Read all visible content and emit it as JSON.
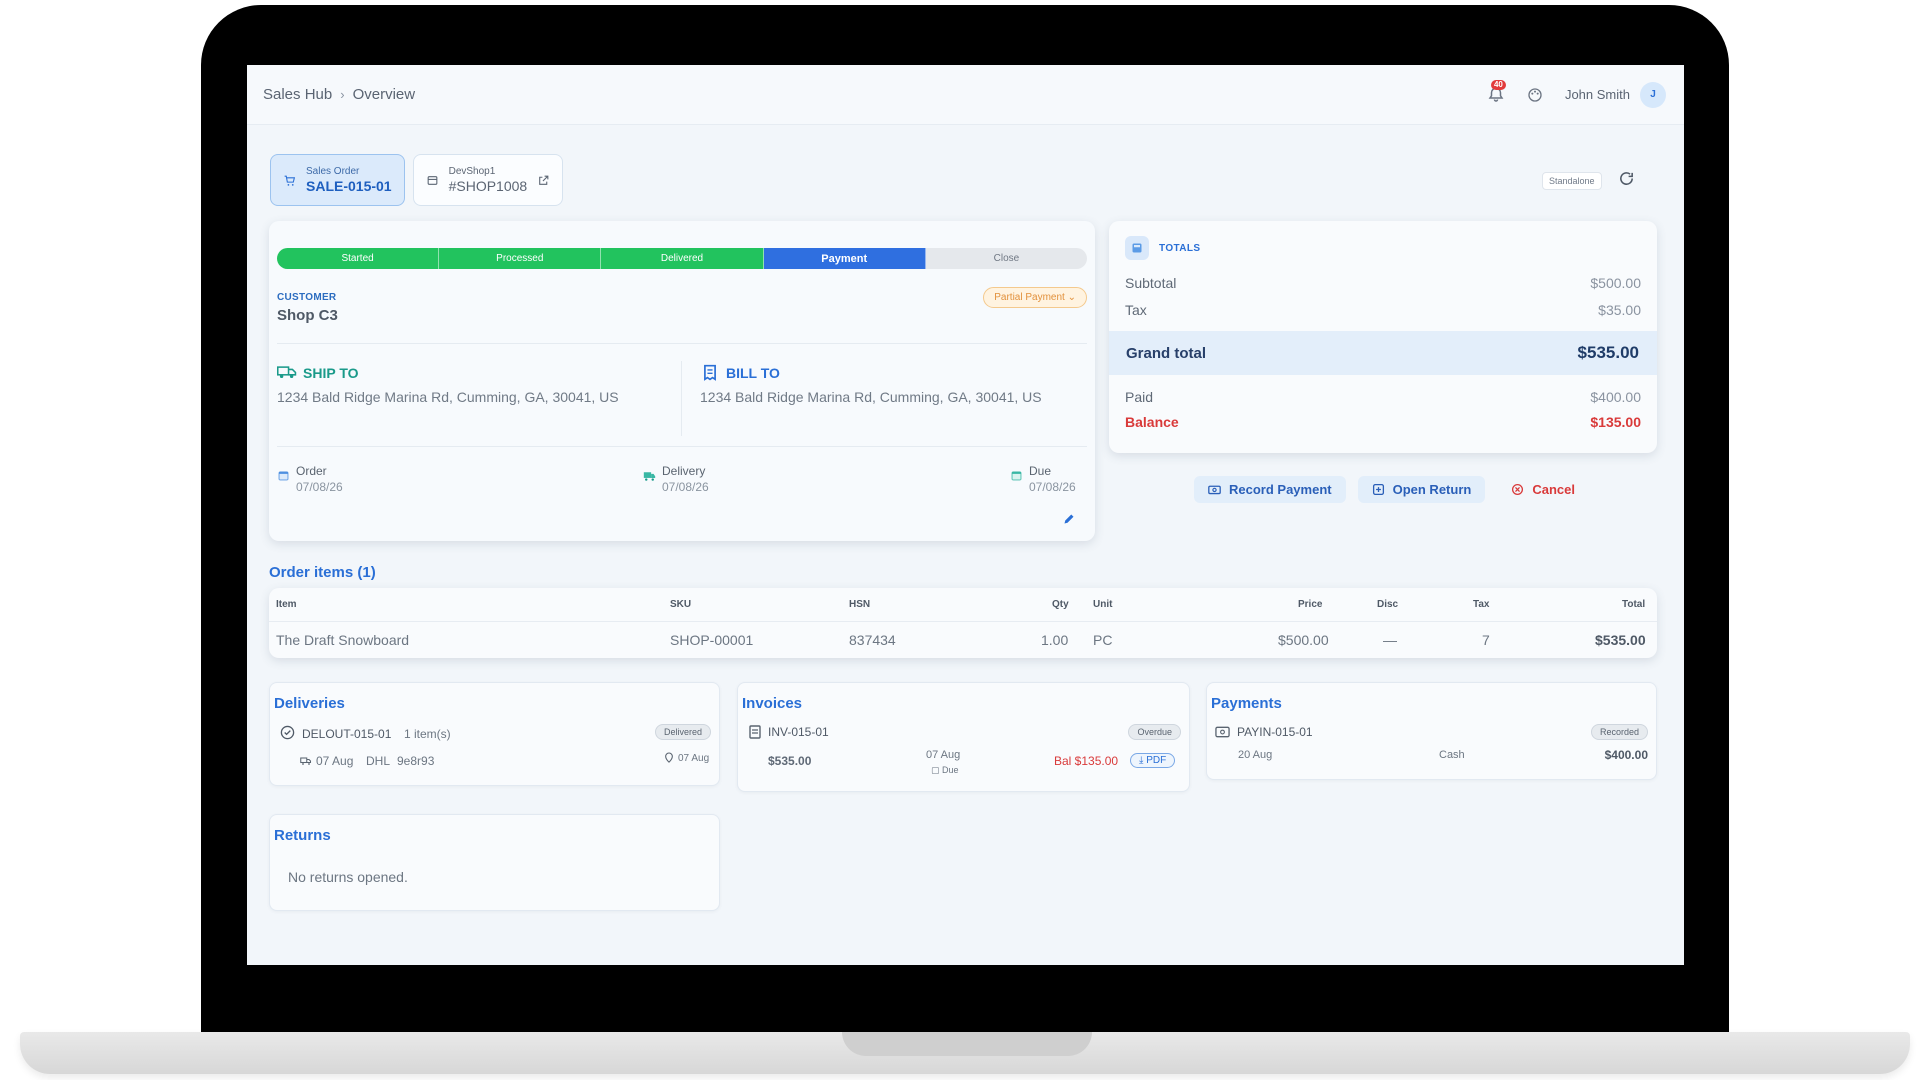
{
  "header": {
    "breadcrumb": [
      "Sales Hub",
      "Overview"
    ],
    "breadcrumb_sep": "›",
    "notification_count": "40",
    "user_name": "John Smith",
    "user_initial": "J"
  },
  "doc_tabs": [
    {
      "kind": "Sales Order",
      "id": "SALE-015-01"
    },
    {
      "kind": "DevShop1",
      "id": "#SHOP1008"
    }
  ],
  "mode_chip": "Standalone",
  "stepper": [
    {
      "label": "Started",
      "state": "done"
    },
    {
      "label": "Processed",
      "state": "done"
    },
    {
      "label": "Delivered",
      "state": "done"
    },
    {
      "label": "Payment",
      "state": "current"
    },
    {
      "label": "Close",
      "state": "todo"
    }
  ],
  "customer": {
    "label": "CUSTOMER",
    "name": "Shop C3",
    "payment_status": "Partial Payment"
  },
  "ship_to": {
    "label": "SHIP TO",
    "address": "1234 Bald Ridge Marina Rd, Cumming, GA, 30041, US"
  },
  "bill_to": {
    "label": "BILL TO",
    "address": "1234 Bald Ridge Marina Rd, Cumming, GA, 30041, US"
  },
  "dates": {
    "order": {
      "label": "Order",
      "value": "07/08/26"
    },
    "delivery": {
      "label": "Delivery",
      "value": "07/08/26"
    },
    "due": {
      "label": "Due",
      "value": "07/08/26"
    }
  },
  "totals": {
    "title": "TOTALS",
    "subtotal_label": "Subtotal",
    "subtotal": "$500.00",
    "tax_label": "Tax",
    "tax": "$35.00",
    "grand_label": "Grand total",
    "grand": "$535.00",
    "paid_label": "Paid",
    "paid": "$400.00",
    "balance_label": "Balance",
    "balance": "$135.00"
  },
  "actions": {
    "record_payment": "Record Payment",
    "open_return": "Open Return",
    "cancel": "Cancel"
  },
  "order_items": {
    "title": "Order items (1)",
    "columns": [
      "Item",
      "SKU",
      "HSN",
      "Qty",
      "Unit",
      "Price",
      "Disc",
      "Tax",
      "Total"
    ],
    "rows": [
      {
        "item": "The Draft Snowboard",
        "sku": "SHOP-00001",
        "hsn": "837434",
        "qty": "1.00",
        "unit": "PC",
        "price": "$500.00",
        "disc": "—",
        "tax": "7",
        "total": "$535.00"
      }
    ]
  },
  "deliveries": {
    "title": "Deliveries",
    "id": "DELOUT-015-01",
    "items": "1 item(s)",
    "status": "Delivered",
    "date": "07 Aug",
    "carrier": "DHL",
    "tracking": "9e8r93",
    "delivered_on": "07 Aug"
  },
  "invoices": {
    "title": "Invoices",
    "id": "INV-015-01",
    "status": "Overdue",
    "amount": "$535.00",
    "date": "07 Aug",
    "due_label": "Due",
    "balance": "Bal $135.00",
    "pdf": "PDF"
  },
  "payments": {
    "title": "Payments",
    "id": "PAYIN-015-01",
    "status": "Recorded",
    "date": "20 Aug",
    "method": "Cash",
    "amount": "$400.00"
  },
  "returns": {
    "title": "Returns",
    "empty": "No returns opened."
  },
  "colors": {
    "accent": "#2a6fd6",
    "success": "#22c35e",
    "danger": "#d93a3a",
    "warning": "#e2913c"
  }
}
